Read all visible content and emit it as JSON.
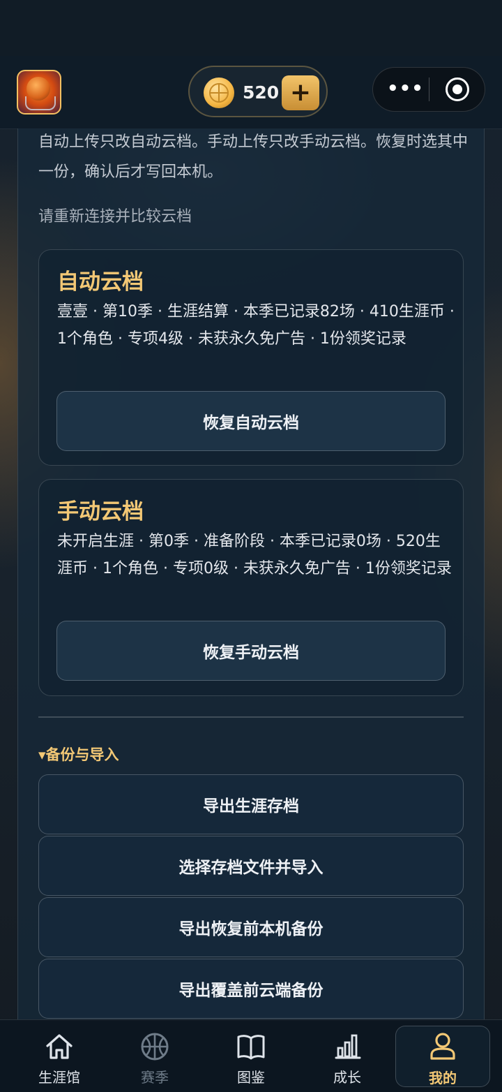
{
  "header": {
    "coin_count": "520",
    "plus_label": "+",
    "menu_glyph": "•••",
    "icons": {
      "app": "basketball-app-icon",
      "coin": "coin-icon",
      "plus": "plus-icon",
      "more": "more-dots-icon",
      "close": "close-miniprogram-icon"
    }
  },
  "content": {
    "description": "自动上传只改自动云档。手动上传只改手动云档。恢复时选其中一份，确认后才写回本机。",
    "reconnect_hint": "请重新连接并比较云档",
    "auto_card": {
      "title": "自动云档",
      "info": "壹壹 · 第10季 · 生涯结算 · 本季已记录82场 · 410生涯币 · 1个角色 · 专项4级 · 未获永久免广告 · 1份领奖记录",
      "button": "恢复自动云档"
    },
    "manual_card": {
      "title": "手动云档",
      "info": "未开启生涯 · 第0季 · 准备阶段 · 本季已记录0场 · 520生涯币 · 1个角色 · 专项0级 · 未获永久免广告 · 1份领奖记录",
      "button": "恢复手动云档"
    },
    "backup_section": {
      "title": "▾备份与导入",
      "buttons": [
        "导出生涯存档",
        "选择存档文件并导入",
        "导出恢复前本机备份",
        "导出覆盖前云端备份"
      ]
    }
  },
  "tabbar": {
    "items": [
      {
        "label": "生涯馆",
        "icon": "home-icon",
        "state": "normal"
      },
      {
        "label": "赛季",
        "icon": "basketball-icon",
        "state": "disabled"
      },
      {
        "label": "图鉴",
        "icon": "book-icon",
        "state": "normal"
      },
      {
        "label": "成长",
        "icon": "bar-chart-icon",
        "state": "normal"
      },
      {
        "label": "我的",
        "icon": "user-icon",
        "state": "active"
      }
    ]
  },
  "colors": {
    "accent": "#f3c875",
    "panel": "#162838",
    "button": "#1d3346"
  }
}
